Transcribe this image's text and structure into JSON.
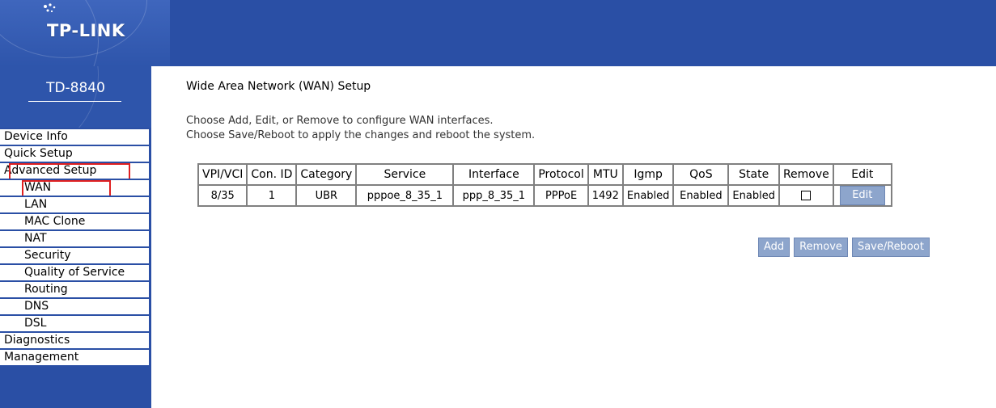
{
  "brand": {
    "logo_text": "TP-LINK",
    "model": "TD-8840"
  },
  "sidebar": {
    "items": [
      {
        "label": "Device Info",
        "level": 1
      },
      {
        "label": "Quick Setup",
        "level": 1
      },
      {
        "label": "Advanced Setup",
        "level": 1,
        "highlighted": true
      },
      {
        "label": "WAN",
        "level": 2,
        "highlighted": true
      },
      {
        "label": "LAN",
        "level": 2
      },
      {
        "label": "MAC Clone",
        "level": 2
      },
      {
        "label": "NAT",
        "level": 2
      },
      {
        "label": "Security",
        "level": 2
      },
      {
        "label": "Quality of Service",
        "level": 2
      },
      {
        "label": "Routing",
        "level": 2
      },
      {
        "label": "DNS",
        "level": 2
      },
      {
        "label": "DSL",
        "level": 2
      },
      {
        "label": "Diagnostics",
        "level": 1
      },
      {
        "label": "Management",
        "level": 1
      }
    ]
  },
  "main": {
    "title": "Wide Area Network (WAN) Setup",
    "description_line1": "Choose Add, Edit, or Remove to configure WAN interfaces.",
    "description_line2": "Choose Save/Reboot to apply the changes and reboot the system.",
    "table": {
      "headers": [
        "VPI/VCI",
        "Con. ID",
        "Category",
        "Service",
        "Interface",
        "Protocol",
        "MTU",
        "Igmp",
        "QoS",
        "State",
        "Remove",
        "Edit"
      ],
      "rows": [
        {
          "vpi_vci": "8/35",
          "con_id": "1",
          "category": "UBR",
          "service": "pppoe_8_35_1",
          "interface": "ppp_8_35_1",
          "protocol": "PPPoE",
          "mtu": "1492",
          "igmp": "Enabled",
          "qos": "Enabled",
          "state": "Enabled",
          "remove_checked": false,
          "edit_label": "Edit"
        }
      ]
    },
    "buttons": {
      "add_label": "Add",
      "remove_label": "Remove",
      "save_reboot_label": "Save/Reboot"
    }
  },
  "colors": {
    "banner": "#2a4fa5",
    "button": "#8da5cc",
    "highlight": "#e02020"
  }
}
